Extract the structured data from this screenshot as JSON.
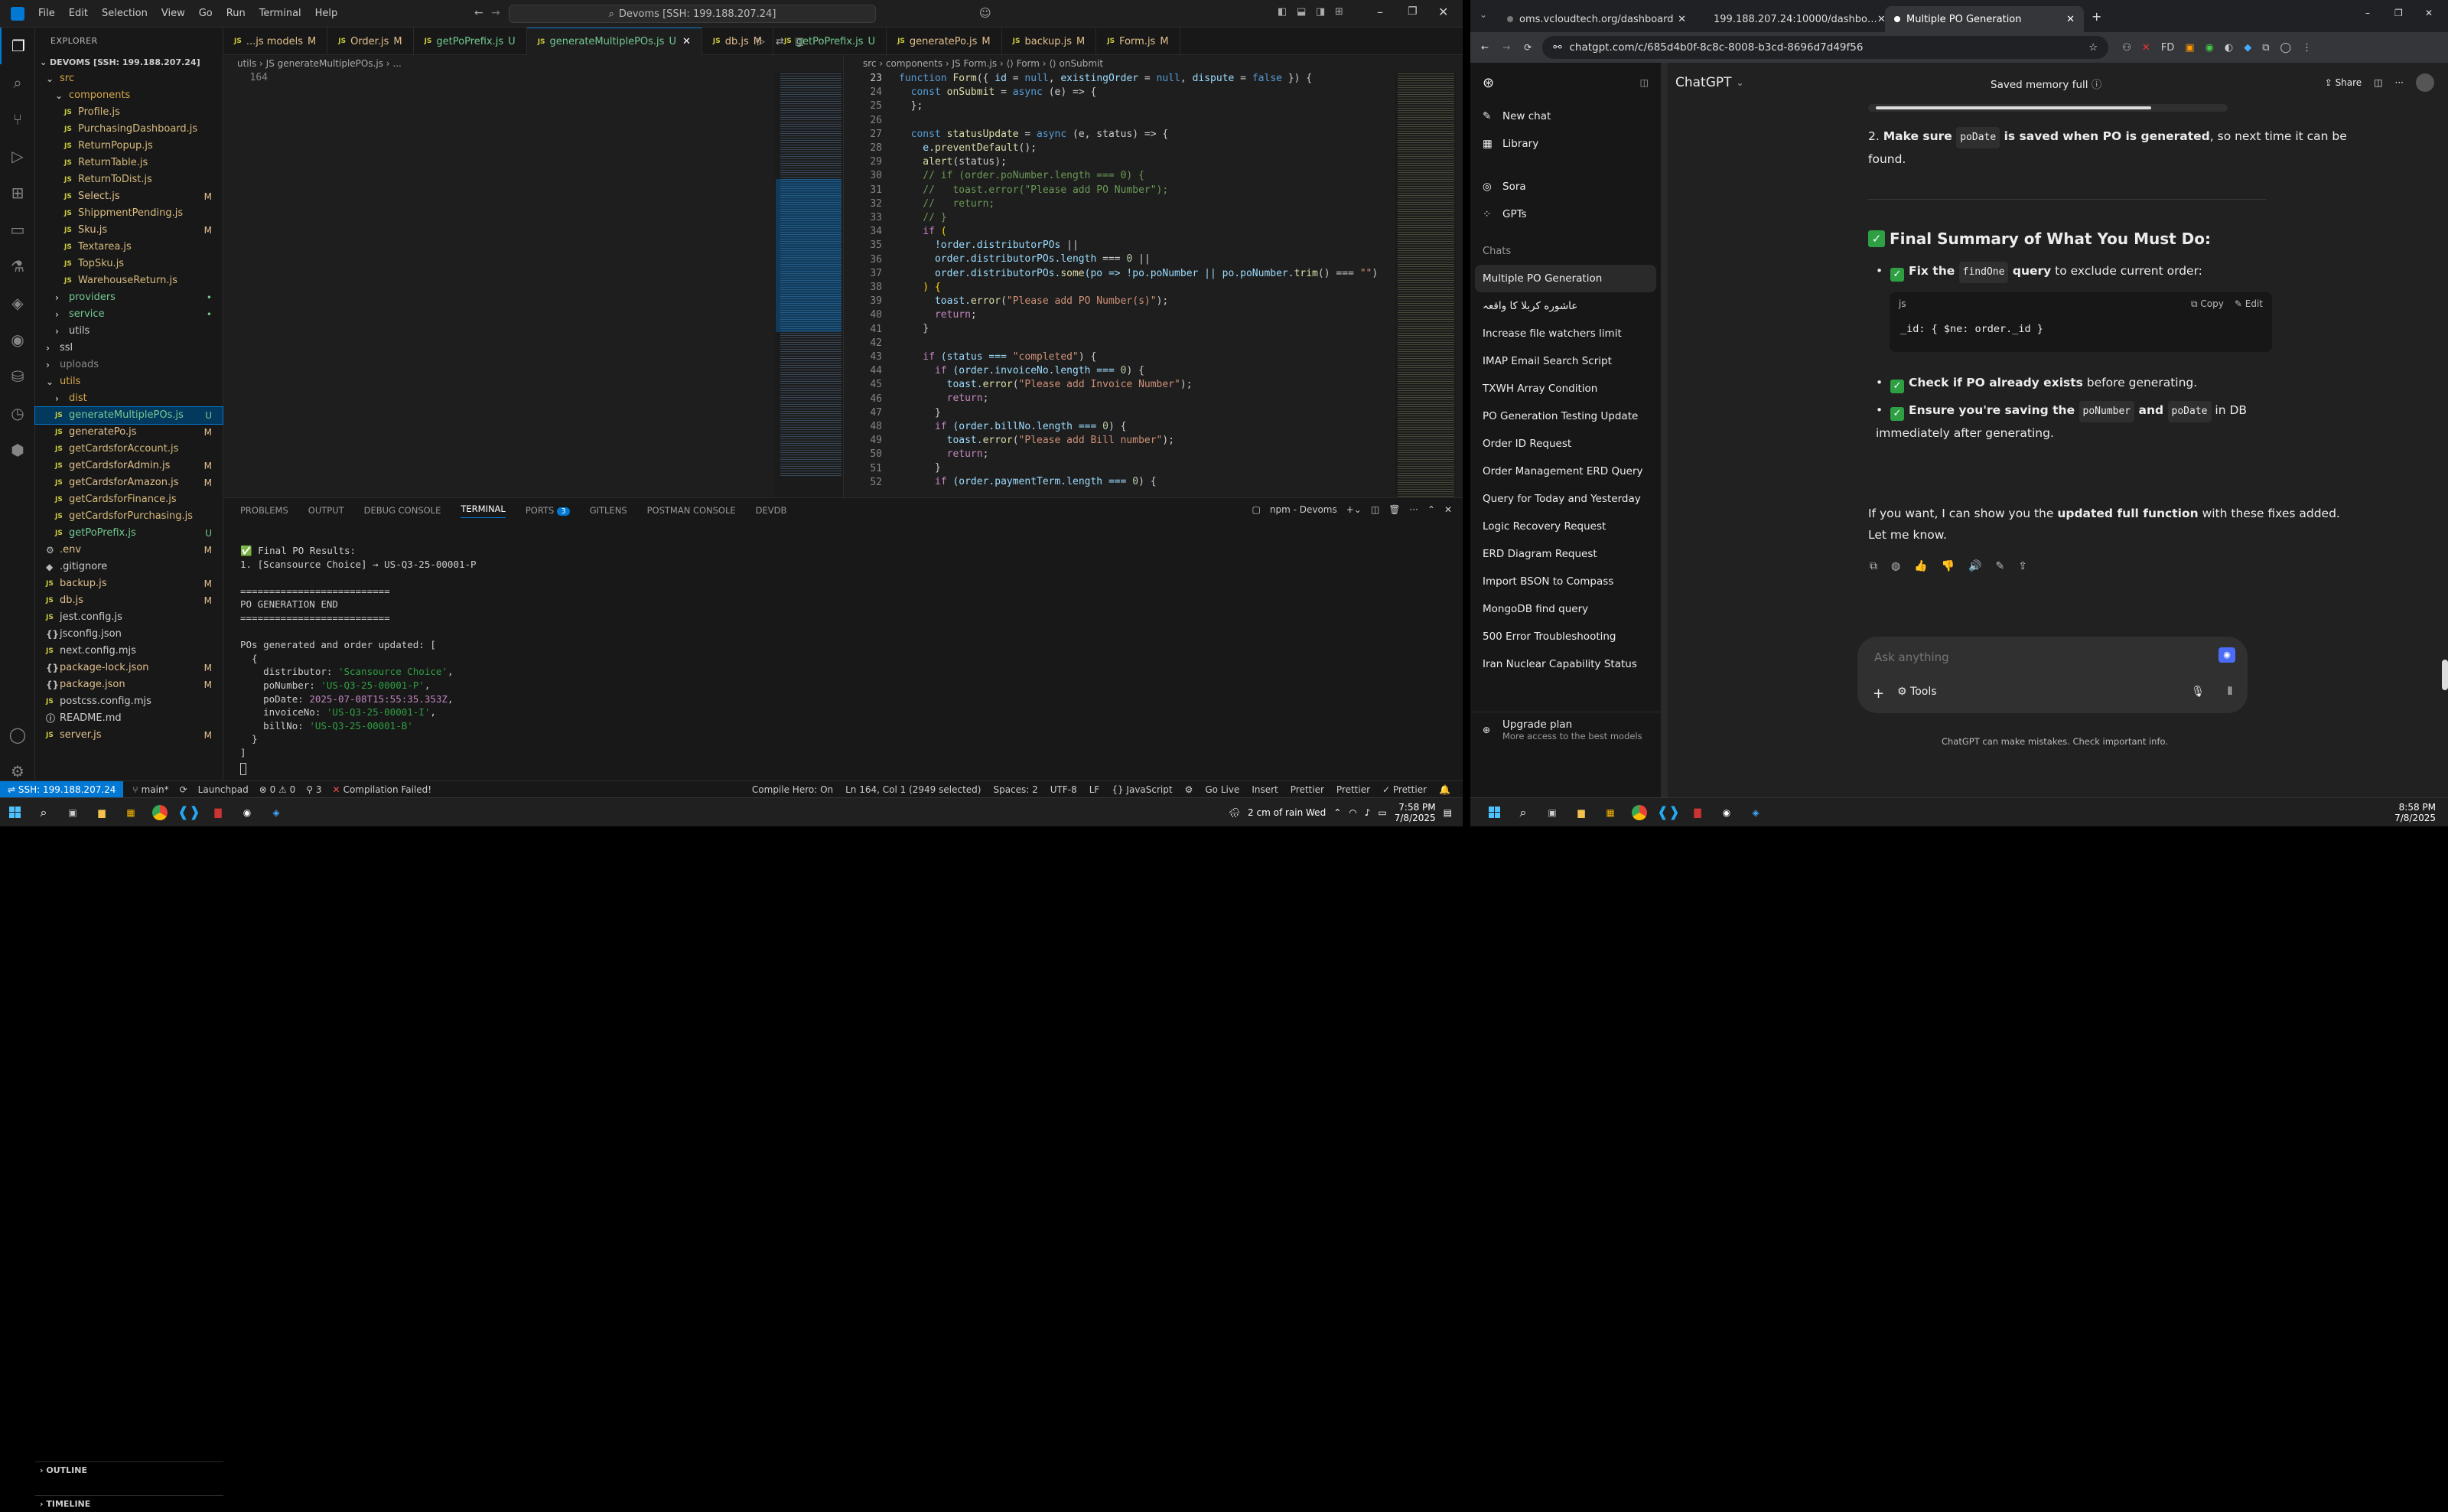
{
  "vscode": {
    "menu": [
      "File",
      "Edit",
      "Selection",
      "View",
      "Go",
      "Run",
      "Terminal",
      "Help"
    ],
    "search": "Devoms [SSH: 199.188.207.24]",
    "explorer_title": "EXPLORER",
    "root": "DEVOMS [SSH: 199.188.207.24]",
    "tree": [
      {
        "t": "src",
        "d": 0,
        "k": "folder",
        "c": "#d4a64a",
        "b": "",
        "bc": ""
      },
      {
        "t": "components",
        "d": 1,
        "k": "folder",
        "c": "#d4a64a",
        "b": "",
        "bc": ""
      },
      {
        "t": "Profile.js",
        "d": 2,
        "k": "js",
        "c": "#d7ba7d",
        "b": "",
        "bc": ""
      },
      {
        "t": "PurchasingDashboard.js",
        "d": 2,
        "k": "js",
        "c": "#d7ba7d",
        "b": "",
        "bc": ""
      },
      {
        "t": "ReturnPopup.js",
        "d": 2,
        "k": "js",
        "c": "#d7ba7d",
        "b": "",
        "bc": ""
      },
      {
        "t": "ReturnTable.js",
        "d": 2,
        "k": "js",
        "c": "#d7ba7d",
        "b": "",
        "bc": ""
      },
      {
        "t": "ReturnToDist.js",
        "d": 2,
        "k": "js",
        "c": "#d7ba7d",
        "b": "",
        "bc": ""
      },
      {
        "t": "Select.js",
        "d": 2,
        "k": "js",
        "c": "#e2c08d",
        "b": "M",
        "bc": "#e2c08d"
      },
      {
        "t": "ShippmentPending.js",
        "d": 2,
        "k": "js",
        "c": "#d7ba7d",
        "b": "",
        "bc": ""
      },
      {
        "t": "Sku.js",
        "d": 2,
        "k": "js",
        "c": "#e2c08d",
        "b": "M",
        "bc": "#e2c08d"
      },
      {
        "t": "Textarea.js",
        "d": 2,
        "k": "js",
        "c": "#d7ba7d",
        "b": "",
        "bc": ""
      },
      {
        "t": "TopSku.js",
        "d": 2,
        "k": "js",
        "c": "#d7ba7d",
        "b": "",
        "bc": ""
      },
      {
        "t": "WarehouseReturn.js",
        "d": 2,
        "k": "js",
        "c": "#d7ba7d",
        "b": "",
        "bc": ""
      },
      {
        "t": "providers",
        "d": 1,
        "k": "folderc",
        "c": "#73c991",
        "b": "•",
        "bc": "#73c991"
      },
      {
        "t": "service",
        "d": 1,
        "k": "folderc",
        "c": "#73c991",
        "b": "•",
        "bc": "#73c991"
      },
      {
        "t": "utils",
        "d": 1,
        "k": "folderc",
        "c": "#ccc",
        "b": "",
        "bc": ""
      },
      {
        "t": "ssl",
        "d": 0,
        "k": "folderc",
        "c": "#ccc",
        "b": "",
        "bc": ""
      },
      {
        "t": "uploads",
        "d": 0,
        "k": "folderc",
        "c": "#888",
        "b": "",
        "bc": ""
      },
      {
        "t": "utils",
        "d": 0,
        "k": "folder",
        "c": "#d4a64a",
        "b": "",
        "bc": ""
      },
      {
        "t": "dist",
        "d": 1,
        "k": "folderc",
        "c": "#d4a64a",
        "b": "",
        "bc": ""
      },
      {
        "t": "generateMultiplePOs.js",
        "d": 1,
        "k": "js",
        "c": "#73c991",
        "b": "U",
        "bc": "#73c991",
        "sel": true
      },
      {
        "t": "generatePo.js",
        "d": 1,
        "k": "js",
        "c": "#e2c08d",
        "b": "M",
        "bc": "#e2c08d"
      },
      {
        "t": "getCardsforAccount.js",
        "d": 1,
        "k": "js",
        "c": "#d7ba7d",
        "b": "",
        "bc": ""
      },
      {
        "t": "getCardsforAdmin.js",
        "d": 1,
        "k": "js",
        "c": "#e2c08d",
        "b": "M",
        "bc": "#e2c08d"
      },
      {
        "t": "getCardsforAmazon.js",
        "d": 1,
        "k": "js",
        "c": "#e2c08d",
        "b": "M",
        "bc": "#e2c08d"
      },
      {
        "t": "getCardsforFinance.js",
        "d": 1,
        "k": "js",
        "c": "#d7ba7d",
        "b": "",
        "bc": ""
      },
      {
        "t": "getCardsforPurchasing.js",
        "d": 1,
        "k": "js",
        "c": "#d7ba7d",
        "b": "",
        "bc": ""
      },
      {
        "t": "getPoPrefix.js",
        "d": 1,
        "k": "js",
        "c": "#73c991",
        "b": "U",
        "bc": "#73c991"
      },
      {
        "t": ".env",
        "d": 0,
        "k": "env",
        "c": "#e2c08d",
        "b": "M",
        "bc": "#e2c08d"
      },
      {
        "t": ".gitignore",
        "d": 0,
        "k": "git",
        "c": "#ccc",
        "b": "",
        "bc": ""
      },
      {
        "t": "backup.js",
        "d": 0,
        "k": "js",
        "c": "#e2c08d",
        "b": "M",
        "bc": "#e2c08d"
      },
      {
        "t": "db.js",
        "d": 0,
        "k": "js",
        "c": "#e2c08d",
        "b": "M",
        "bc": "#e2c08d"
      },
      {
        "t": "jest.config.js",
        "d": 0,
        "k": "js",
        "c": "#ccc",
        "b": "",
        "bc": ""
      },
      {
        "t": "jsconfig.json",
        "d": 0,
        "k": "json",
        "c": "#ccc",
        "b": "",
        "bc": ""
      },
      {
        "t": "next.config.mjs",
        "d": 0,
        "k": "js",
        "c": "#ccc",
        "b": "",
        "bc": ""
      },
      {
        "t": "package-lock.json",
        "d": 0,
        "k": "json",
        "c": "#e2c08d",
        "b": "M",
        "bc": "#e2c08d"
      },
      {
        "t": "package.json",
        "d": 0,
        "k": "json",
        "c": "#e2c08d",
        "b": "M",
        "bc": "#e2c08d"
      },
      {
        "t": "postcss.config.mjs",
        "d": 0,
        "k": "js",
        "c": "#ccc",
        "b": "",
        "bc": ""
      },
      {
        "t": "README.md",
        "d": 0,
        "k": "md",
        "c": "#ccc",
        "b": "",
        "bc": ""
      },
      {
        "t": "server.js",
        "d": 0,
        "k": "js",
        "c": "#e2c08d",
        "b": "M",
        "bc": "#e2c08d"
      }
    ],
    "outline": "OUTLINE",
    "timeline": "TIMELINE",
    "tabs": [
      {
        "n": "...js models",
        "s": "M",
        "c": "#e2c08d"
      },
      {
        "n": "Order.js",
        "s": "M",
        "c": "#e2c08d"
      },
      {
        "n": "getPoPrefix.js",
        "s": "U",
        "c": "#73c991"
      },
      {
        "n": "generateMultiplePOs.js",
        "s": "U",
        "c": "#73c991",
        "active": true
      },
      {
        "n": "db.js",
        "s": "M",
        "c": "#e2c08d"
      },
      {
        "n": "getPoPrefix.js",
        "s": "U",
        "c": "#73c991"
      },
      {
        "n": "generatePo.js",
        "s": "M",
        "c": "#e2c08d"
      },
      {
        "n": "backup.js",
        "s": "M",
        "c": "#e2c08d"
      },
      {
        "n": "Form.js",
        "s": "M",
        "c": "#e2c08d"
      }
    ],
    "crumb_left": "utils  ›  JS generateMultiplePOs.js  ›  ...",
    "crumb_right": "src  ›  components  ›  JS Form.js  ›  ⟨⟩ Form  ›  ⟨⟩ onSubmit",
    "left_line_no": "164",
    "code_start": 23,
    "code": [
      [
        [
          "function ",
          "#569cd6"
        ],
        [
          "Form",
          "#dcdcaa"
        ],
        [
          "({ ",
          "#ccc"
        ],
        [
          "id",
          "#9cdcfe"
        ],
        [
          " = ",
          "#ccc"
        ],
        [
          "null",
          "#569cd6"
        ],
        [
          ", ",
          "#ccc"
        ],
        [
          "existingOrder",
          "#9cdcfe"
        ],
        [
          " = ",
          "#ccc"
        ],
        [
          "null",
          "#569cd6"
        ],
        [
          ", ",
          "#ccc"
        ],
        [
          "dispute",
          "#9cdcfe"
        ],
        [
          " = ",
          "#ccc"
        ],
        [
          "false",
          "#569cd6"
        ],
        [
          " }) {",
          "#ccc"
        ]
      ],
      [
        [
          "  const ",
          "#569cd6"
        ],
        [
          "onSubmit",
          "#dcdcaa"
        ],
        [
          " = ",
          "#ccc"
        ],
        [
          "async",
          "#569cd6"
        ],
        [
          " (e) => {",
          "#ccc"
        ]
      ],
      [
        [
          "  };",
          "#ccc"
        ]
      ],
      [
        [
          "",
          "#ccc"
        ]
      ],
      [
        [
          "  const ",
          "#569cd6"
        ],
        [
          "statusUpdate",
          "#dcdcaa"
        ],
        [
          " = ",
          "#ccc"
        ],
        [
          "async",
          "#569cd6"
        ],
        [
          " (e, status) => {",
          "#ccc"
        ]
      ],
      [
        [
          "    e.",
          "#9cdcfe"
        ],
        [
          "preventDefault",
          "#dcdcaa"
        ],
        [
          "();",
          "#ccc"
        ]
      ],
      [
        [
          "    alert",
          "#dcdcaa"
        ],
        [
          "(status);",
          "#ccc"
        ]
      ],
      [
        [
          "    // if (order.poNumber.length === 0) {",
          "#6a9955"
        ]
      ],
      [
        [
          "    //   toast.error(\"Please add PO Number\");",
          "#6a9955"
        ]
      ],
      [
        [
          "    //   return;",
          "#6a9955"
        ]
      ],
      [
        [
          "    // }",
          "#6a9955"
        ]
      ],
      [
        [
          "    if ",
          "#c586c0"
        ],
        [
          "(",
          "#ffd700"
        ]
      ],
      [
        [
          "      !order.",
          "#9cdcfe"
        ],
        [
          "distributorPOs",
          "#9cdcfe"
        ],
        [
          " ||",
          "#ccc"
        ]
      ],
      [
        [
          "      order.",
          "#9cdcfe"
        ],
        [
          "distributorPOs.",
          "#9cdcfe"
        ],
        [
          "length",
          "#9cdcfe"
        ],
        [
          " === ",
          "#ccc"
        ],
        [
          "0",
          "#b5cea8"
        ],
        [
          " ||",
          "#ccc"
        ]
      ],
      [
        [
          "      order.",
          "#9cdcfe"
        ],
        [
          "distributorPOs.",
          "#9cdcfe"
        ],
        [
          "some",
          "#dcdcaa"
        ],
        [
          "(po => !po.poNumber || po.poNumber.",
          "#9cdcfe"
        ],
        [
          "trim",
          "#dcdcaa"
        ],
        [
          "() === ",
          "#ccc"
        ],
        [
          "\"\"",
          "#ce9178"
        ],
        [
          ")",
          "#ccc"
        ]
      ],
      [
        [
          "    ) {",
          "#ffd700"
        ]
      ],
      [
        [
          "      toast.",
          "#9cdcfe"
        ],
        [
          "error",
          "#dcdcaa"
        ],
        [
          "(",
          "#ccc"
        ],
        [
          "\"Please add PO Number(s)\"",
          "#ce9178"
        ],
        [
          ");",
          "#ccc"
        ]
      ],
      [
        [
          "      return",
          "#c586c0"
        ],
        [
          ";",
          "#ccc"
        ]
      ],
      [
        [
          "    }",
          "#ccc"
        ]
      ],
      [
        [
          "",
          "#ccc"
        ]
      ],
      [
        [
          "    if ",
          "#c586c0"
        ],
        [
          "(status === ",
          "#9cdcfe"
        ],
        [
          "\"completed\"",
          "#ce9178"
        ],
        [
          ") {",
          "#ccc"
        ]
      ],
      [
        [
          "      if ",
          "#c586c0"
        ],
        [
          "(order.invoiceNo.length === ",
          "#9cdcfe"
        ],
        [
          "0",
          "#b5cea8"
        ],
        [
          ") {",
          "#ccc"
        ]
      ],
      [
        [
          "        toast.",
          "#9cdcfe"
        ],
        [
          "error",
          "#dcdcaa"
        ],
        [
          "(",
          "#ccc"
        ],
        [
          "\"Please add Invoice Number\"",
          "#ce9178"
        ],
        [
          ");",
          "#ccc"
        ]
      ],
      [
        [
          "        return",
          "#c586c0"
        ],
        [
          ";",
          "#ccc"
        ]
      ],
      [
        [
          "      }",
          "#ccc"
        ]
      ],
      [
        [
          "      if ",
          "#c586c0"
        ],
        [
          "(order.billNo.length === ",
          "#9cdcfe"
        ],
        [
          "0",
          "#b5cea8"
        ],
        [
          ") {",
          "#ccc"
        ]
      ],
      [
        [
          "        toast.",
          "#9cdcfe"
        ],
        [
          "error",
          "#dcdcaa"
        ],
        [
          "(",
          "#ccc"
        ],
        [
          "\"Please add Bill number\"",
          "#ce9178"
        ],
        [
          ");",
          "#ccc"
        ]
      ],
      [
        [
          "        return",
          "#c586c0"
        ],
        [
          ";",
          "#ccc"
        ]
      ],
      [
        [
          "      }",
          "#ccc"
        ]
      ],
      [
        [
          "      if ",
          "#c586c0"
        ],
        [
          "(order.paymentTerm.length === ",
          "#9cdcfe"
        ],
        [
          "0",
          "#b5cea8"
        ],
        [
          ") {",
          "#ccc"
        ]
      ]
    ],
    "panel_tabs": [
      "PROBLEMS",
      "OUTPUT",
      "DEBUG CONSOLE",
      "TERMINAL",
      "PORTS",
      "GITLENS",
      "POSTMAN CONSOLE",
      "DEVDB"
    ],
    "ports_badge": "3",
    "term_name": "npm - Devoms",
    "terminal": [
      [
        [
          "✅ Final PO Results:",
          "#ccc"
        ]
      ],
      [
        [
          "1. [Scansource Choice] → US-Q3-25-00001-P",
          "#ccc"
        ]
      ],
      [
        [
          "",
          "#ccc"
        ]
      ],
      [
        [
          "==========================",
          "#ccc"
        ]
      ],
      [
        [
          "PO GENERATION END",
          "#ccc"
        ]
      ],
      [
        [
          "==========================",
          "#ccc"
        ]
      ],
      [
        [
          "",
          "#ccc"
        ]
      ],
      [
        [
          "POs generated and order updated: [",
          "#ccc"
        ]
      ],
      [
        [
          "  {",
          "#ccc"
        ]
      ],
      [
        [
          "    distributor: ",
          "#ccc"
        ],
        [
          "'Scansource Choice'",
          "#2ea043"
        ],
        [
          ",",
          "#ccc"
        ]
      ],
      [
        [
          "    poNumber: ",
          "#ccc"
        ],
        [
          "'US-Q3-25-00001-P'",
          "#2ea043"
        ],
        [
          ",",
          "#ccc"
        ]
      ],
      [
        [
          "    poDate: ",
          "#ccc"
        ],
        [
          "2025-07-08T15:55:35.353Z",
          "#c586c0"
        ],
        [
          ",",
          "#ccc"
        ]
      ],
      [
        [
          "    invoiceNo: ",
          "#ccc"
        ],
        [
          "'US-Q3-25-00001-I'",
          "#2ea043"
        ],
        [
          ",",
          "#ccc"
        ]
      ],
      [
        [
          "    billNo: ",
          "#ccc"
        ],
        [
          "'US-Q3-25-00001-B'",
          "#2ea043"
        ]
      ],
      [
        [
          "  }",
          "#ccc"
        ]
      ],
      [
        [
          "]",
          "#ccc"
        ]
      ]
    ],
    "status": {
      "remote": "SSH: 199.188.207.24",
      "branch": "main*",
      "launchpad": "Launchpad",
      "errors": "⊗ 0  ⚠ 0",
      "ports": "⚲ 3",
      "compile": "Compilation Failed!",
      "compile_hero": "Compile Hero: On",
      "pos": "Ln 164, Col 1 (2949 selected)",
      "spaces": "Spaces: 2",
      "enc": "UTF-8",
      "eol": "LF",
      "lang": "{} JavaScript",
      "golive": "Go Live",
      "insert": "Insert",
      "prettier1": "Prettier",
      "prettier2": "Prettier",
      "prettier3": "✓ Prettier"
    },
    "taskbar": {
      "weather": "2 cm of rain Wed",
      "time": "7:58 PM",
      "date": "7/8/2025"
    }
  },
  "chrome": {
    "tabs": [
      "oms.vcloudtech.org/dashboard",
      "199.188.207.24:10000/dashbo…",
      "Multiple PO Generation"
    ],
    "url": "chatgpt.com/c/685d4b0f-8c8c-8008-b3cd-8696d7d49f56",
    "side_items": [
      "New chat",
      "Library",
      "Sora",
      "GPTs"
    ],
    "chats_label": "Chats",
    "chats": [
      "Multiple PO Generation",
      "عاشوره کربلا کا واقعہ",
      "Increase file watchers limit",
      "IMAP Email Search Script",
      "TXWH Array Condition",
      "PO Generation Testing Update",
      "Order ID Request",
      "Order Management ERD Query",
      "Query for Today and Yesterday",
      "Logic Recovery Request",
      "ERD Diagram Request",
      "Import BSON to Compass",
      "MongoDB find query",
      "500 Error Troubleshooting",
      "Iran Nuclear Capability Status"
    ],
    "upgrade": "Upgrade plan",
    "upgrade_sub": "More access to the best models",
    "model": "ChatGPT",
    "memory": "Saved memory full",
    "share": "Share",
    "item2_pre": "Make sure ",
    "item2_code": "poDate",
    "item2_bold": " is saved when PO is generated",
    "item2_post": ", so next time it can be found.",
    "summary": "Final Summary of What You Must Do:",
    "b1_pre": "Fix the ",
    "b1_code": "findOne",
    "b1_bold": " query",
    "b1_post": " to exclude current order:",
    "code_lang": "js",
    "copy": "Copy",
    "edit": "Edit",
    "code_line": "_id: { $ne: order._id }",
    "b2_bold": "Check if PO already exists",
    "b2_post": " before generating.",
    "b3_bold": "Ensure you're saving the ",
    "b3_code1": "poNumber",
    "b3_and": " and ",
    "b3_code2": "poDate",
    "b3_post": " in DB immediately after generating.",
    "closing_pre": "If you want, I can show you the ",
    "closing_bold": "updated full function",
    "closing_post": " with these fixes added. Let me know.",
    "placeholder": "Ask anything",
    "tools": "Tools",
    "disclaimer": "ChatGPT can make mistakes. Check important info.",
    "taskbar": {
      "time": "8:58 PM",
      "date": "7/8/2025"
    }
  }
}
